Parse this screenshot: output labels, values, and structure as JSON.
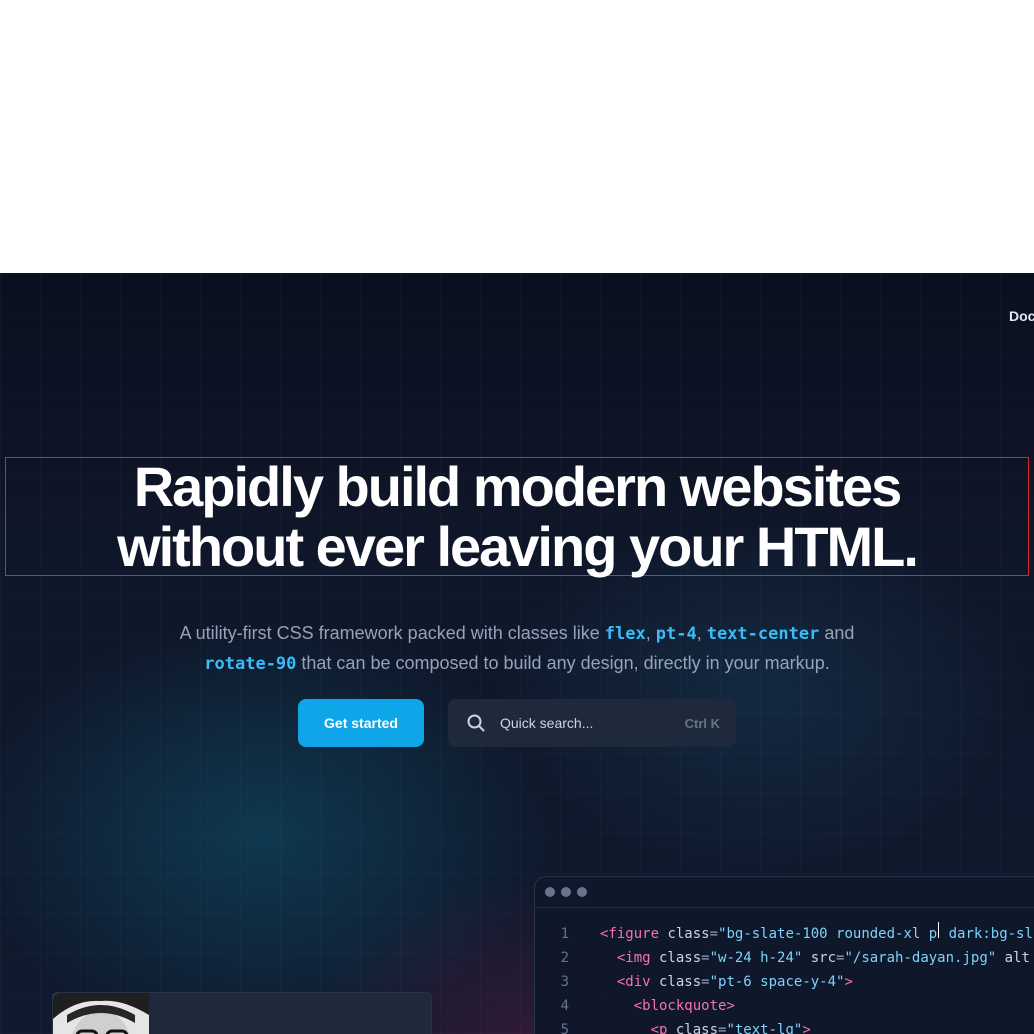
{
  "nav": {
    "docs_label": "Doc"
  },
  "hero": {
    "headline_line1": "Rapidly build modern websites",
    "headline_line2": "without ever leaving your HTML.",
    "sub_part1": "A utility-first CSS framework packed with classes like ",
    "sub_code1": "flex",
    "sub_sep1": ", ",
    "sub_code2": "pt-4",
    "sub_sep2": ", ",
    "sub_code3": "text-center",
    "sub_part2": " and ",
    "sub_code4": "rotate-90",
    "sub_part3": " that can be composed to build any design, directly in your markup."
  },
  "cta": {
    "get_started_label": "Get started"
  },
  "search": {
    "placeholder": "Quick search...",
    "shortcut": "Ctrl K",
    "icon": "search-icon"
  },
  "editor": {
    "lines": [
      {
        "n": "1",
        "indent": "",
        "tag": "<figure",
        "a1": " class",
        "s1": "\"bg-slate-100 rounded-xl p",
        "s1b": " dark:bg-sl"
      },
      {
        "n": "2",
        "indent": "  ",
        "tag": "<img",
        "a1": " class",
        "s1": "\"w-24 h-24\"",
        "a2": " src",
        "s2": "\"/sarah-dayan.jpg\"",
        "a3": " alt"
      },
      {
        "n": "3",
        "indent": "  ",
        "tag": "<div",
        "a1": " class",
        "s1": "\"pt-6 space-y-4\"",
        "end": ">"
      },
      {
        "n": "4",
        "indent": "    ",
        "tag": "<blockquote",
        "end": ">"
      },
      {
        "n": "5",
        "indent": "      ",
        "tag": "<p",
        "a1": " class",
        "s1": "\"text-lg\"",
        "end": ">"
      }
    ]
  },
  "colors": {
    "accent": "#0ea5e9",
    "background": "#0f172a",
    "code_token": "#38bdf8"
  }
}
